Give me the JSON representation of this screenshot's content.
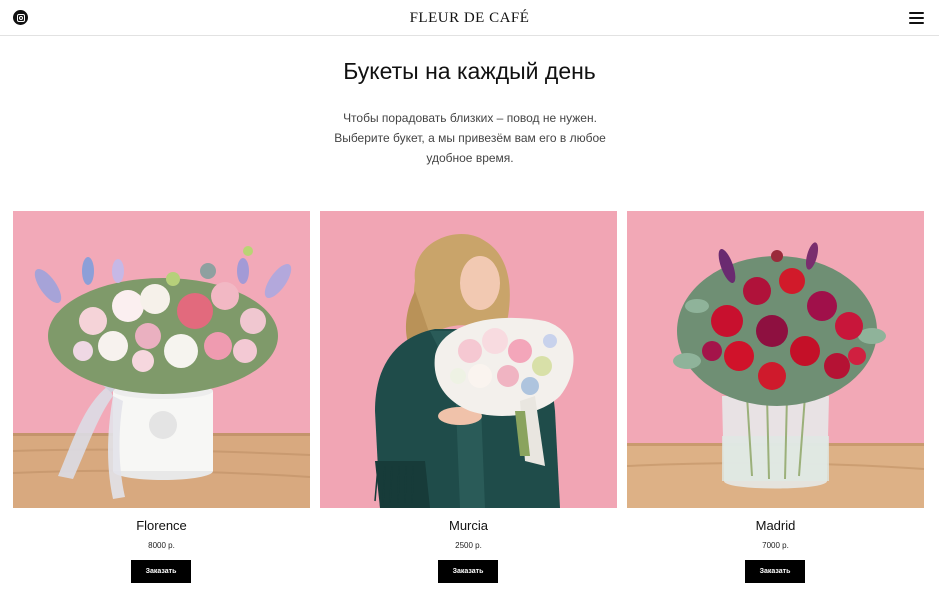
{
  "header": {
    "logo_text": "FLEUR DE CAFÉ",
    "instagram_icon": "instagram-icon",
    "menu_icon": "hamburger-menu-icon"
  },
  "main": {
    "title": "Букеты на каждый день",
    "intro_lines": [
      "Чтобы порадовать близких – повод не нужен.",
      "Выберите букет, а мы привезём вам его в любое",
      "удобное время."
    ]
  },
  "products": [
    {
      "name": "Florence",
      "price": "8000 р.",
      "button_label": "Заказать"
    },
    {
      "name": "Murcia",
      "price": "2500 р.",
      "button_label": "Заказать"
    },
    {
      "name": "Madrid",
      "price": "7000 р.",
      "button_label": "Заказать"
    }
  ],
  "colors": {
    "background": "#ffffff",
    "photo_backdrop_pink": "#f0a8b6",
    "table_wood": "#d9ab82",
    "button_bg": "#000000",
    "button_text": "#ffffff",
    "text": "#111111"
  }
}
